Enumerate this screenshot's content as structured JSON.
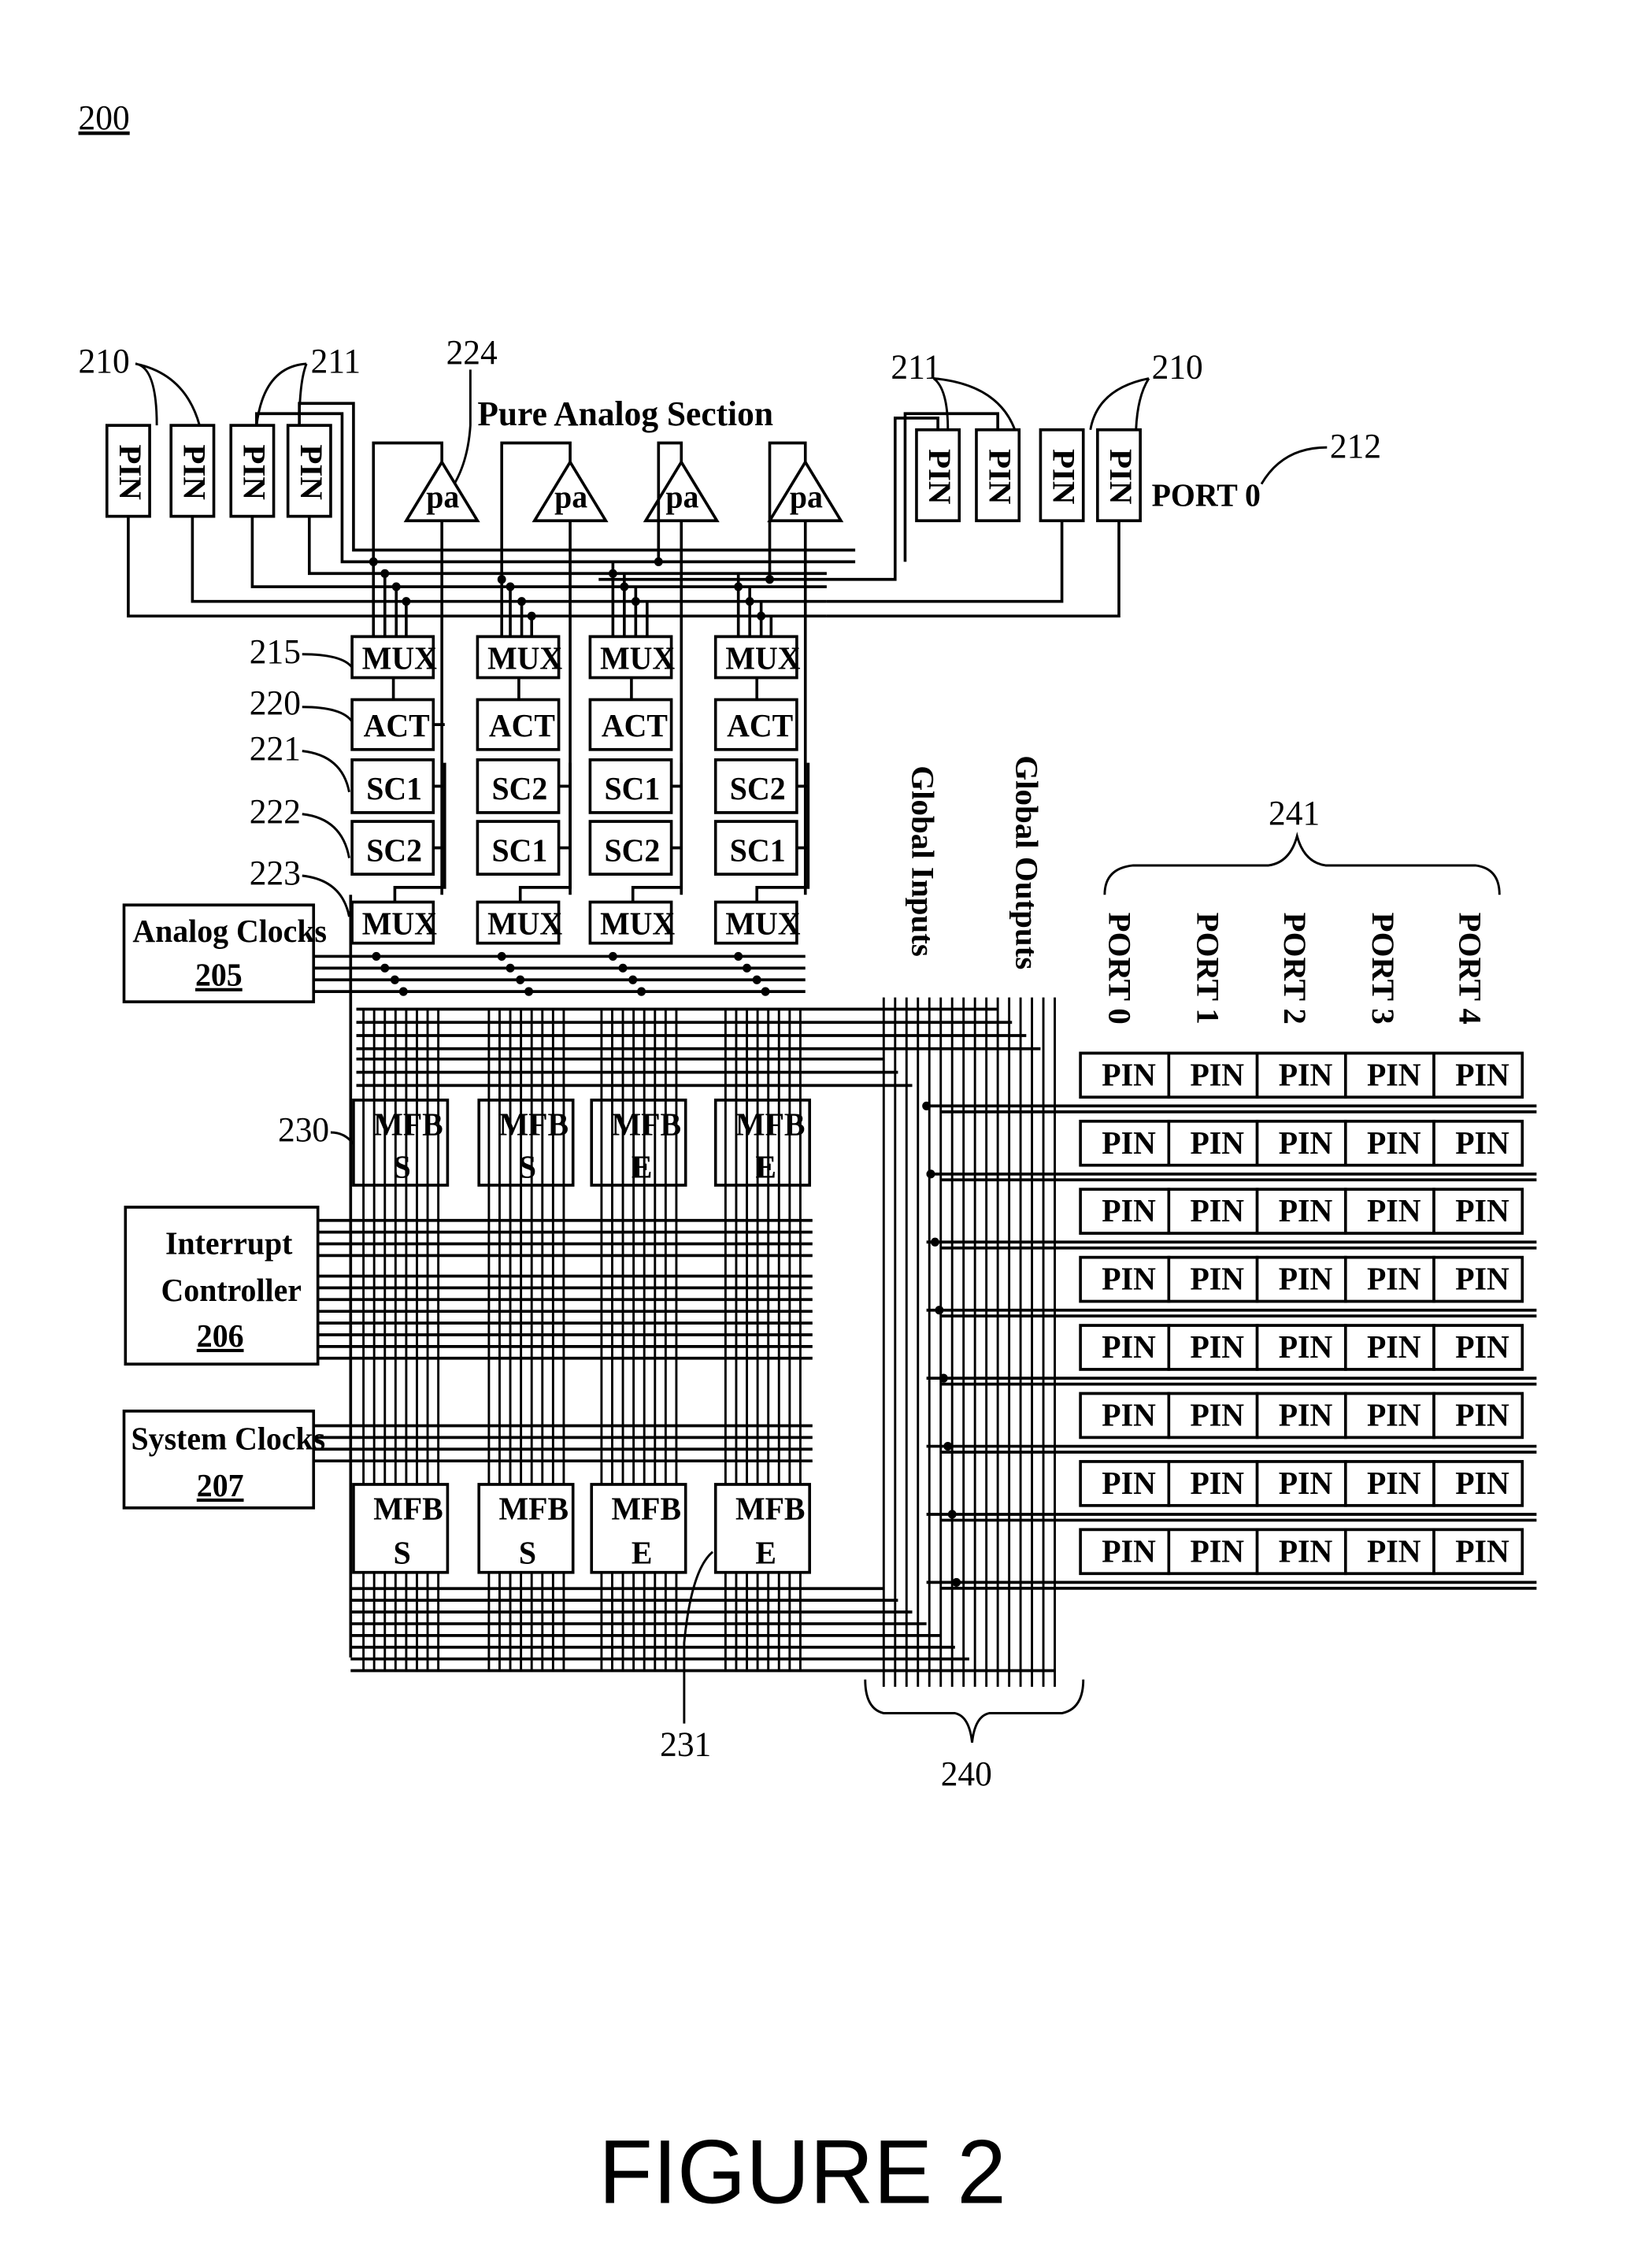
{
  "figure": {
    "ref_number": "200",
    "caption": "FIGURE 2"
  },
  "pure_analog_section": {
    "title": "Pure Analog Section",
    "ref": "224",
    "amplifier_label": "pa",
    "amplifier_count": 4
  },
  "left_pins": {
    "label": "PIN",
    "refs": [
      "210",
      "211"
    ]
  },
  "right_pins": {
    "label": "PIN",
    "refs": [
      "211",
      "210"
    ],
    "port_label": "PORT 0",
    "port_ref": "212"
  },
  "analog_columns": [
    {
      "mux_top": "MUX",
      "act": "ACT",
      "sc_a": "SC1",
      "sc_b": "SC2",
      "mux_bottom": "MUX"
    },
    {
      "mux_top": "MUX",
      "act": "ACT",
      "sc_a": "SC2",
      "sc_b": "SC1",
      "mux_bottom": "MUX"
    },
    {
      "mux_top": "MUX",
      "act": "ACT",
      "sc_a": "SC1",
      "sc_b": "SC2",
      "mux_bottom": "MUX"
    },
    {
      "mux_top": "MUX",
      "act": "ACT",
      "sc_a": "SC2",
      "sc_b": "SC1",
      "mux_bottom": "MUX"
    }
  ],
  "analog_refs": {
    "mux": "215",
    "act": "220",
    "sc1": "221",
    "sc2": "222",
    "mux_bottom": "223"
  },
  "blocks": {
    "analog_clocks": {
      "label": "Analog Clocks",
      "ref": "205"
    },
    "interrupt_controller": {
      "label_line1": "Interrupt",
      "label_line2": "Controller",
      "ref": "206"
    },
    "system_clocks": {
      "label": "System Clocks",
      "ref": "207"
    }
  },
  "mfb_top_row": {
    "ref": "230",
    "blocks": [
      {
        "name": "MFB",
        "type": "S"
      },
      {
        "name": "MFB",
        "type": "S"
      },
      {
        "name": "MFB",
        "type": "E"
      },
      {
        "name": "MFB",
        "type": "E"
      }
    ]
  },
  "mfb_bottom_row": {
    "ref": "231",
    "blocks": [
      {
        "name": "MFB",
        "type": "S"
      },
      {
        "name": "MFB",
        "type": "S"
      },
      {
        "name": "MFB",
        "type": "E"
      },
      {
        "name": "MFB",
        "type": "E"
      }
    ]
  },
  "global_bus": {
    "inputs_label": "Global Inputs",
    "outputs_label": "Global Outputs",
    "ref": "240"
  },
  "port_array": {
    "ref": "241",
    "ports": [
      "PORT 0",
      "PORT 1",
      "PORT 2",
      "PORT 3",
      "PORT 4"
    ],
    "pin_label": "PIN",
    "rows": 8
  }
}
